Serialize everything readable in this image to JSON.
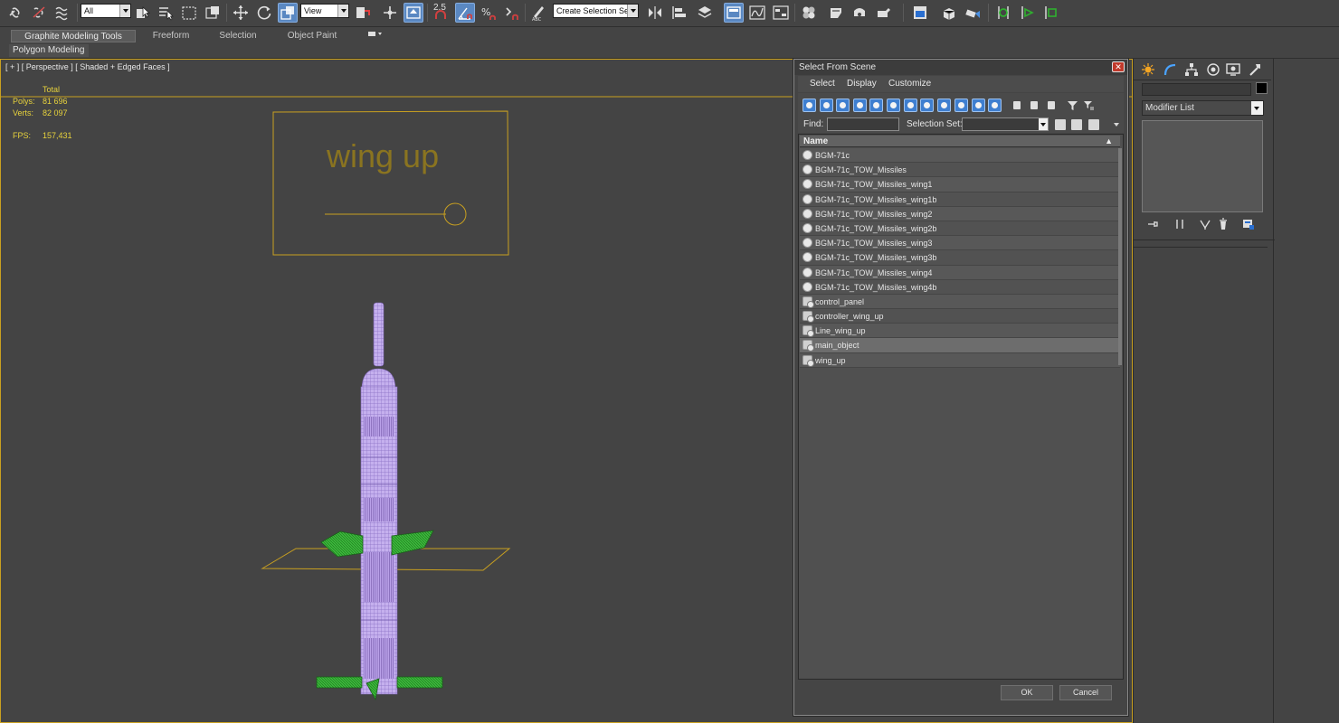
{
  "toolbar": {
    "filter_value": "All",
    "coord_system_value": "View",
    "snap_value": "2.5",
    "named_selection_value": "Create Selection Se"
  },
  "ribbon": {
    "tabs": [
      {
        "label": "Graphite Modeling Tools",
        "active": true
      },
      {
        "label": "Freeform"
      },
      {
        "label": "Selection"
      },
      {
        "label": "Object Paint"
      }
    ],
    "panel_label": "Polygon Modeling"
  },
  "viewport": {
    "label": "[ + ] [ Perspective ] [ Shaded + Edged Faces ]",
    "stats": {
      "total_label": "Total",
      "polys_label": "Polys:",
      "polys_value": "81 696",
      "verts_label": "Verts:",
      "verts_value": "82 097",
      "fps_label": "FPS:",
      "fps_value": "157,431"
    },
    "control_panel_text": "wing up",
    "colors": {
      "stat_text": "#e7d23c",
      "wire_yellow": "#c9a020",
      "missile": "#b9a0e8",
      "wing": "#2fa02f"
    }
  },
  "dialog": {
    "title": "Select From Scene",
    "menu": [
      "Select",
      "Display",
      "Customize"
    ],
    "find_label": "Find:",
    "find_value": "",
    "selection_set_label": "Selection Set:",
    "column_header": "Name",
    "objects": [
      {
        "name": "BGM-71c",
        "type": "geometry"
      },
      {
        "name": "BGM-71c_TOW_Missiles",
        "type": "geometry"
      },
      {
        "name": "BGM-71c_TOW_Missiles_wing1",
        "type": "geometry"
      },
      {
        "name": "BGM-71c_TOW_Missiles_wing1b",
        "type": "geometry"
      },
      {
        "name": "BGM-71c_TOW_Missiles_wing2",
        "type": "geometry"
      },
      {
        "name": "BGM-71c_TOW_Missiles_wing2b",
        "type": "geometry"
      },
      {
        "name": "BGM-71c_TOW_Missiles_wing3",
        "type": "geometry"
      },
      {
        "name": "BGM-71c_TOW_Missiles_wing3b",
        "type": "geometry"
      },
      {
        "name": "BGM-71c_TOW_Missiles_wing4",
        "type": "geometry"
      },
      {
        "name": "BGM-71c_TOW_Missiles_wing4b",
        "type": "geometry"
      },
      {
        "name": "control_panel",
        "type": "shape"
      },
      {
        "name": "controller_wing_up",
        "type": "shape"
      },
      {
        "name": "Line_wing_up",
        "type": "shape"
      },
      {
        "name": "main_object",
        "type": "shape",
        "selected": true
      },
      {
        "name": "wing_up",
        "type": "shape"
      }
    ],
    "ok_label": "OK",
    "cancel_label": "Cancel"
  },
  "command_panel": {
    "object_name": "",
    "modifier_list_label": "Modifier List",
    "color_swatch": "#000000",
    "tabs": [
      "create-icon",
      "modify-icon",
      "hierarchy-icon",
      "motion-icon",
      "display-icon",
      "utilities-icon"
    ]
  }
}
